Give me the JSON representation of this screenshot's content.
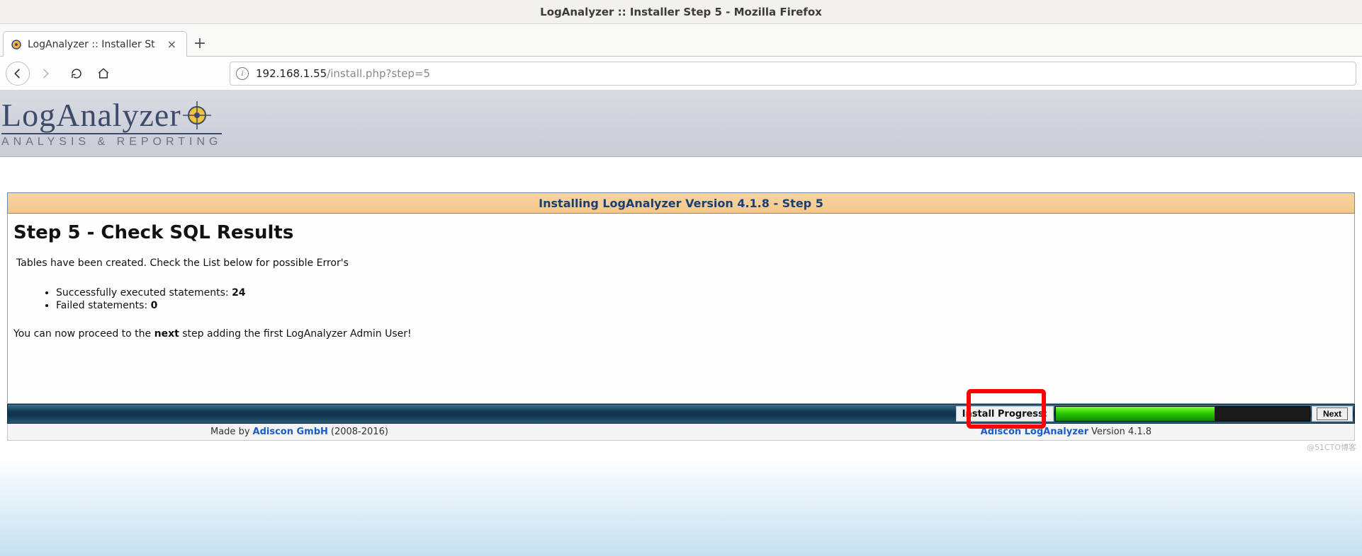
{
  "window": {
    "title": "LogAnalyzer :: Installer Step 5 - Mozilla Firefox"
  },
  "tab": {
    "label": "LogAnalyzer :: Installer St"
  },
  "url": {
    "host": "192.168.1.55",
    "path": "/install.php?step=5"
  },
  "logo": {
    "main": "LogAnalyzer",
    "sub": "ANALYSIS & REPORTING"
  },
  "install_header": "Installing LogAnalyzer Version 4.1.8 - Step 5",
  "step": {
    "title": "Step 5 - Check SQL Results",
    "description": "Tables have been created. Check the List below for possible Error's",
    "success_label": "Successfully executed statements:",
    "success_count": "24",
    "failed_label": "Failed statements:",
    "failed_count": "0",
    "proceed_pre": "You can now proceed to the ",
    "proceed_bold": "next",
    "proceed_post": " step adding the first LogAnalyzer Admin User!"
  },
  "progress": {
    "label": "Install Progress:",
    "percent": 62.5,
    "next_label": "Next"
  },
  "footer": {
    "madeby_pre": "Made by ",
    "madeby_link": "Adiscon GmbH",
    "madeby_years": " (2008-2016)",
    "product_link": "Adiscon LogAnalyzer",
    "product_version": " Version 4.1.8"
  },
  "watermark": "@51CTO博客"
}
